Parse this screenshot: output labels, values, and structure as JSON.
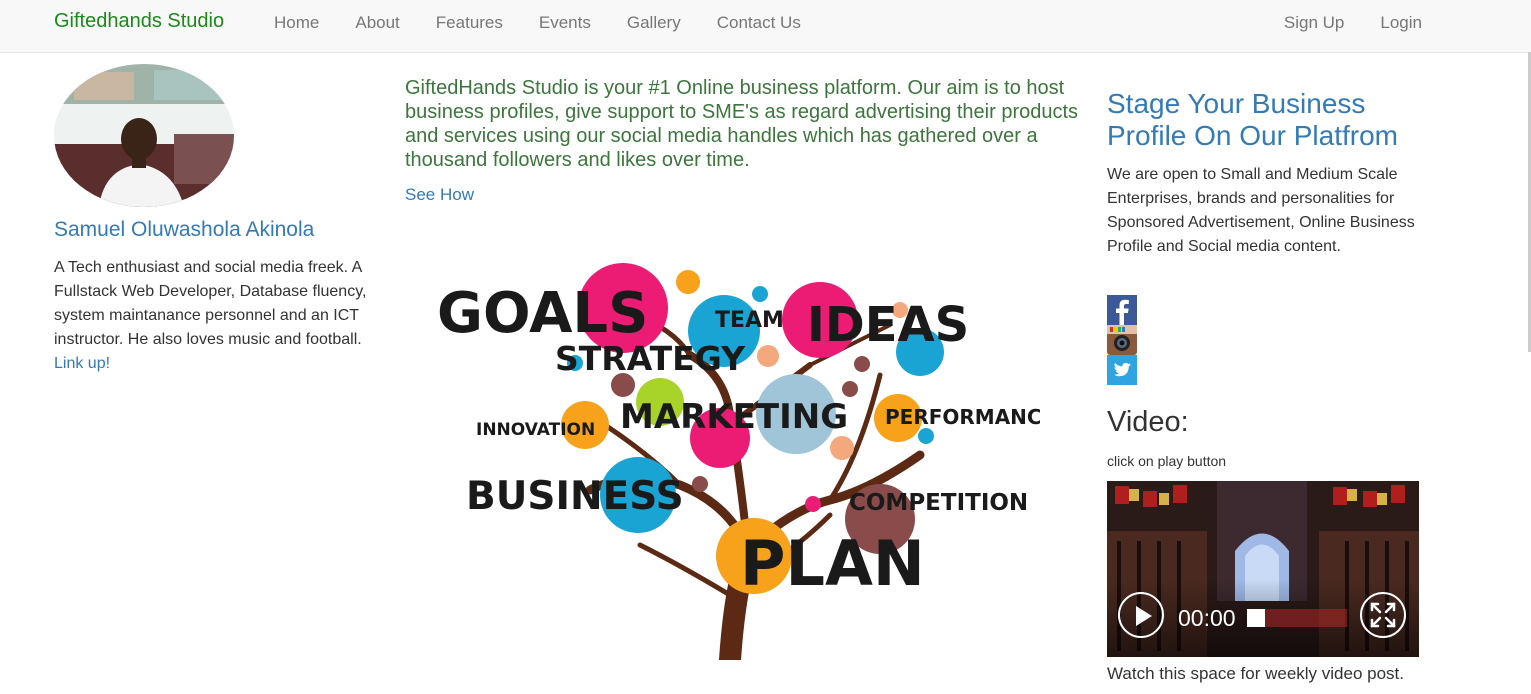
{
  "navbar": {
    "brand": "Giftedhands Studio",
    "links": [
      "Home",
      "About",
      "Features",
      "Events",
      "Gallery",
      "Contact Us"
    ],
    "right_links": [
      "Sign Up",
      "Login"
    ]
  },
  "profile": {
    "name": "Samuel Oluwashola Akinola",
    "bio": "A Tech enthusiast and social media freek. A Fullstack Web Developer, Database fluency, system maintanance personnel and an ICT instructor. He also loves music and football.",
    "link_text": "Link up!"
  },
  "intro": {
    "text": "GiftedHands Studio is your #1 Online business platform. Our aim is to host business profiles, give support to SME's as regard advertising their products and services using our social media handles which has gathered over a thousand followers and likes over time.",
    "see_how": "See How"
  },
  "tree_words": {
    "goals": "GOALS",
    "team": "TEAM",
    "ideas": "IDEAS",
    "strategy": "STRATEGY",
    "innovation": "INNOVATION",
    "marketing": "MARKETING",
    "performance": "PERFORMANCE",
    "business": "BUSINESS",
    "competition": "COMPETITION",
    "plan": "PLAN"
  },
  "stage": {
    "title": "Stage Your Business Profile On Our Platfrom",
    "text": "We are open to Small and Medium Scale Enterprises, brands and personalities for Sponsored Advertisement, Online Business Profile and Social media content."
  },
  "social_icons": [
    "facebook-icon",
    "instagram-icon",
    "twitter-icon"
  ],
  "video": {
    "heading": "Video:",
    "hint": "click on play button",
    "time": "00:00",
    "caption": "Watch this space for weekly video post."
  },
  "colors": {
    "brand": "#1a8a1a",
    "link": "#337ab7",
    "intro": "#3c763d",
    "nav_text": "#777777"
  }
}
